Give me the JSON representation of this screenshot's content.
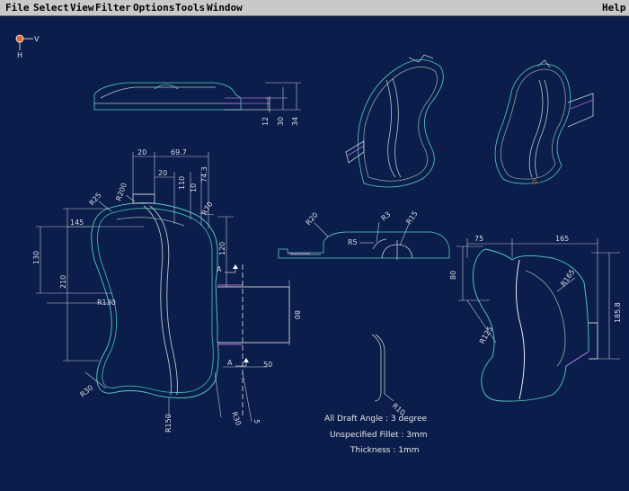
{
  "menubar": {
    "file": "File",
    "select": "Select",
    "view": "View",
    "filter": "Filter",
    "options": "Options",
    "tools": "Tools",
    "window": "Window",
    "help": "Help"
  },
  "axis": {
    "x_label": "V",
    "y_label": "H"
  },
  "dimensions": {
    "d_12": "12",
    "d_30": "30",
    "d_34": "34",
    "d_20_top": "20",
    "d_69_7": "69.7",
    "d_20_b": "20",
    "d_110": "110",
    "d_10": "10",
    "d_74_3": "74.3",
    "r_25": "R25",
    "r_200": "R200",
    "r_70": "R70",
    "d_145": "145",
    "d_130": "130",
    "d_210": "210",
    "d_120": "120",
    "r_130": "R130",
    "d_80": "80",
    "d_50": "50",
    "r_30_left": "R30",
    "r_30_bottom": "R30",
    "r_150": "R150",
    "d_5": "5",
    "section_a1": "A",
    "section_a2": "A",
    "r_20": "R20",
    "r_3": "R3",
    "r_15": "R15",
    "r_5": "R5",
    "r_10": "R10",
    "d_75": "75",
    "d_165": "165",
    "d_80_right": "80",
    "r_165": "R165",
    "d_185_8": "185.8",
    "r_125": "R125"
  },
  "notes": {
    "draft": "All Draft Angle : 3 degree",
    "fillet": "Unspecified Fillet : 3mm",
    "thickness": "Thickness : 1mm"
  },
  "colors": {
    "background": "#0b1d4a",
    "outline": "#4fd3c4",
    "dimension": "#c9ccd6",
    "accent": "#b06cd6",
    "menubar": "#c9c9c9"
  }
}
